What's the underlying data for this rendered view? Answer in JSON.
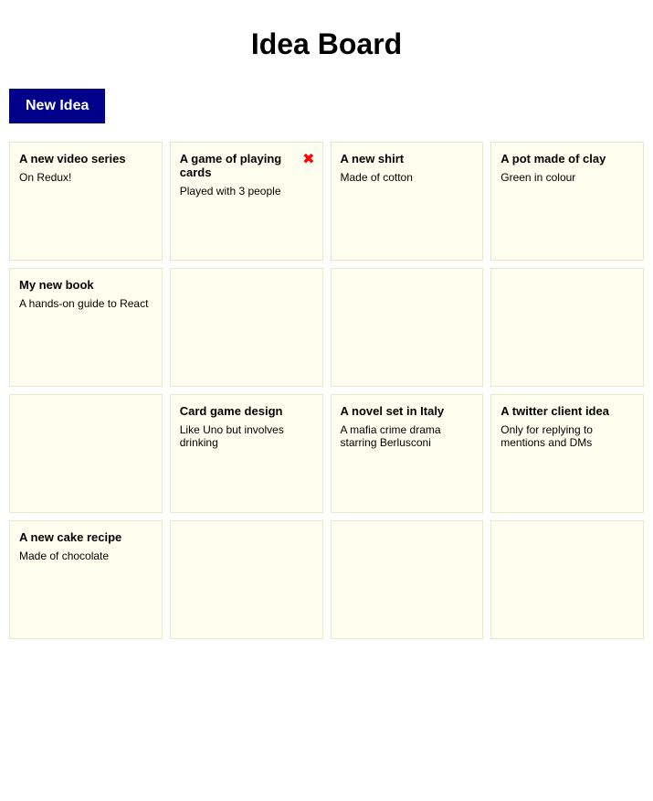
{
  "page": {
    "title": "Idea Board"
  },
  "toolbar": {
    "new_idea_label": "New Idea"
  },
  "cards": [
    {
      "id": "card-1",
      "title": "A new video series",
      "description": "On Redux!",
      "empty": false
    },
    {
      "id": "card-2",
      "title": "A game of playing cards",
      "description": "Played with 3 people",
      "empty": false,
      "has_cursor": true
    },
    {
      "id": "card-3",
      "title": "A new shirt",
      "description": "Made of cotton",
      "empty": false
    },
    {
      "id": "card-4",
      "title": "A pot made of clay",
      "description": "Green in colour",
      "empty": false
    },
    {
      "id": "card-5",
      "title": "My new book",
      "description": "A hands-on guide to React",
      "empty": false
    },
    {
      "id": "card-6",
      "title": "",
      "description": "",
      "empty": true
    },
    {
      "id": "card-7",
      "title": "",
      "description": "",
      "empty": true
    },
    {
      "id": "card-8",
      "title": "",
      "description": "",
      "empty": true
    },
    {
      "id": "card-9",
      "title": "",
      "description": "",
      "empty": true
    },
    {
      "id": "card-10",
      "title": "Card game design",
      "description": "Like Uno but involves drinking",
      "empty": false
    },
    {
      "id": "card-11",
      "title": "A novel set in Italy",
      "description": "A mafia crime drama starring Berlusconi",
      "empty": false
    },
    {
      "id": "card-12",
      "title": "A twitter client idea",
      "description": "Only for replying to mentions and DMs",
      "empty": false
    },
    {
      "id": "card-13",
      "title": "A new cake recipe",
      "description": "Made of chocolate",
      "empty": false
    },
    {
      "id": "card-14",
      "title": "",
      "description": "",
      "empty": true
    },
    {
      "id": "card-15",
      "title": "",
      "description": "",
      "empty": true
    },
    {
      "id": "card-16",
      "title": "",
      "description": "",
      "empty": true
    }
  ]
}
